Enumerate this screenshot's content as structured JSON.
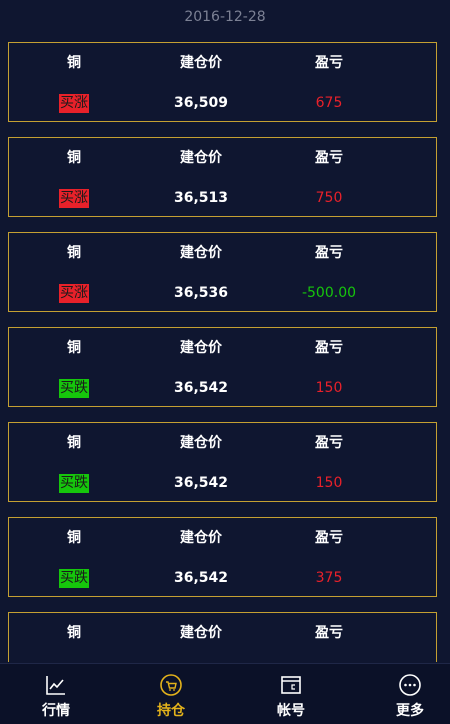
{
  "date": "2016-12-28",
  "columns": {
    "product": "铜",
    "open_price": "建仓价",
    "pnl": "盈亏"
  },
  "positions": [
    {
      "direction": "买涨",
      "type": "up",
      "price": "36,509",
      "pnl": "675",
      "pnl_sign": "pos"
    },
    {
      "direction": "买涨",
      "type": "up",
      "price": "36,513",
      "pnl": "750",
      "pnl_sign": "pos"
    },
    {
      "direction": "买涨",
      "type": "up",
      "price": "36,536",
      "pnl": "-500.00",
      "pnl_sign": "neg"
    },
    {
      "direction": "买跌",
      "type": "down",
      "price": "36,542",
      "pnl": "150",
      "pnl_sign": "pos"
    },
    {
      "direction": "买跌",
      "type": "down",
      "price": "36,542",
      "pnl": "150",
      "pnl_sign": "pos"
    },
    {
      "direction": "买跌",
      "type": "down",
      "price": "36,542",
      "pnl": "375",
      "pnl_sign": "pos"
    },
    {
      "direction": "",
      "type": "",
      "price": "",
      "pnl": "",
      "pnl_sign": ""
    }
  ],
  "tabs": [
    {
      "label": "行情",
      "icon": "chart-line-icon",
      "active": false
    },
    {
      "label": "持仓",
      "icon": "shopping-basket-icon",
      "active": true
    },
    {
      "label": "帐号",
      "icon": "wallet-icon",
      "active": false
    },
    {
      "label": "更多",
      "icon": "more-dots-icon",
      "active": false
    }
  ],
  "colors": {
    "background": "#0f1630",
    "border": "#c4a032",
    "up": "#e8212a",
    "down": "#16c60c",
    "active_tab": "#e3b21b"
  }
}
